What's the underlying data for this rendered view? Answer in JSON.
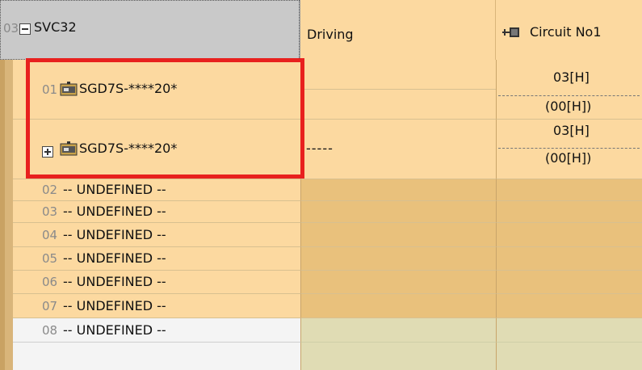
{
  "header": {
    "axis_number": "03",
    "group_label": "SVC32",
    "column_driving": "Driving",
    "column_circuit": "Circuit No1"
  },
  "devices": [
    {
      "index": "01",
      "name": "SGD7S-****20*",
      "driving": "",
      "circuit": "03[H]",
      "circuit_sub": "(00[H])"
    },
    {
      "index": "",
      "name": "SGD7S-****20*",
      "driving": "-----",
      "circuit": "03[H]",
      "circuit_sub": "(00[H])"
    }
  ],
  "undefined_rows": [
    {
      "index": "02",
      "label": "-- UNDEFINED --"
    },
    {
      "index": "03",
      "label": "-- UNDEFINED --"
    },
    {
      "index": "04",
      "label": "-- UNDEFINED --"
    },
    {
      "index": "05",
      "label": "-- UNDEFINED --"
    },
    {
      "index": "06",
      "label": "-- UNDEFINED --"
    },
    {
      "index": "07",
      "label": "-- UNDEFINED --"
    },
    {
      "index": "08",
      "label": "-- UNDEFINED --"
    }
  ],
  "colors": {
    "header_gray": "#c9c9c9",
    "row_orange": "#fcd9a0",
    "row_tan": "#e9c17c",
    "row_light": "#f4f4f4",
    "row_greenish": "#e0dcb4",
    "highlight_red": "#e8201e"
  },
  "icons": {
    "collapse": "minus-box-icon",
    "expand": "plus-box-icon",
    "device": "servo-drive-icon",
    "circuit": "circuit-connector-icon"
  }
}
